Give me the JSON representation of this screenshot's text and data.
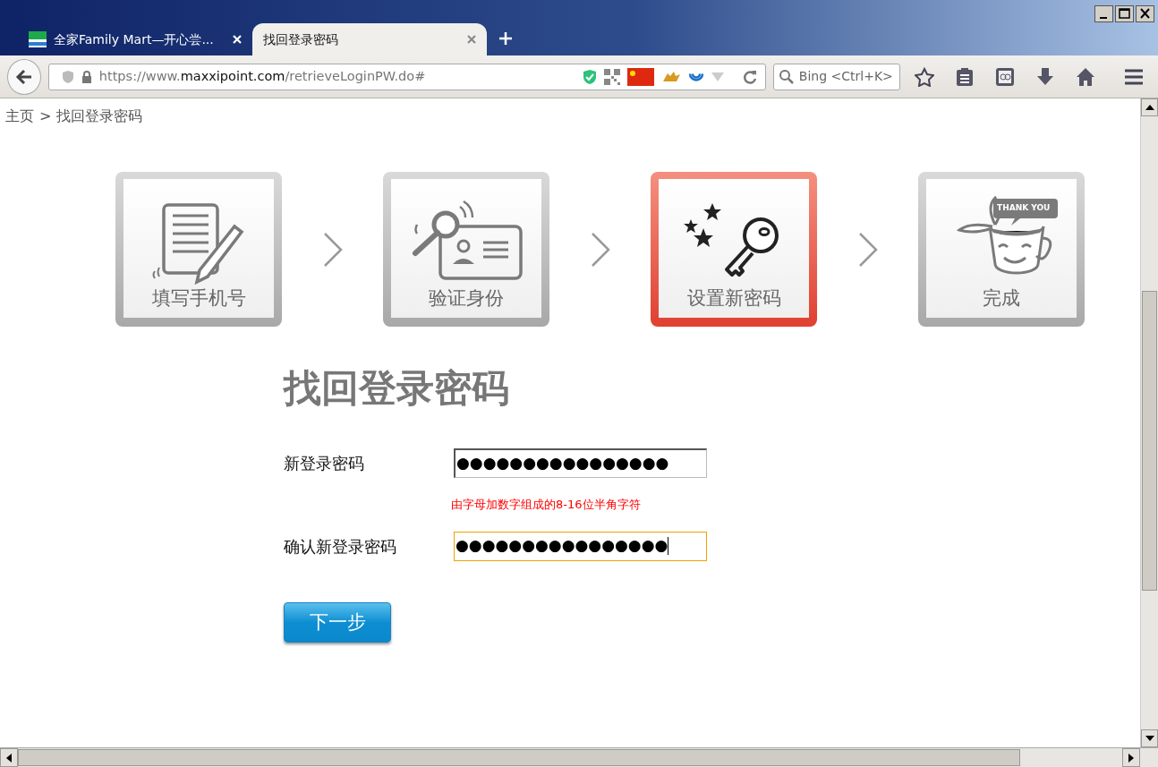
{
  "tabs": [
    {
      "label": "全家Family Mart—开心尝...",
      "selected": false
    },
    {
      "label": "找回登录密码",
      "selected": true
    }
  ],
  "address_bar": {
    "prefix": "https://www.",
    "domain": "maxxipoint.com",
    "path": "/retrieveLoginPW.do#"
  },
  "search": {
    "placeholder": "Bing <Ctrl+K>"
  },
  "breadcrumb": {
    "items": [
      "主页",
      "找回登录密码"
    ],
    "separator": ">"
  },
  "steps": [
    {
      "kind": "phone",
      "label": "填写手机号",
      "selected": false
    },
    {
      "kind": "identity",
      "label": "验证身份",
      "selected": false
    },
    {
      "kind": "key",
      "label": "设置新密码",
      "selected": true
    },
    {
      "kind": "done",
      "label": "完成",
      "badge": "THANK YOU",
      "selected": false
    }
  ],
  "form": {
    "title": "找回登录密码",
    "fields": [
      {
        "label": "新登录密码",
        "value": "●●●●●●●●●●●●●●●●",
        "focused": false,
        "hint": "由字母加数字组成的8-16位半角字符"
      },
      {
        "label": "确认新登录密码",
        "value": "●●●●●●●●●●●●●●●●",
        "focused": true
      }
    ],
    "button": "下一步"
  }
}
